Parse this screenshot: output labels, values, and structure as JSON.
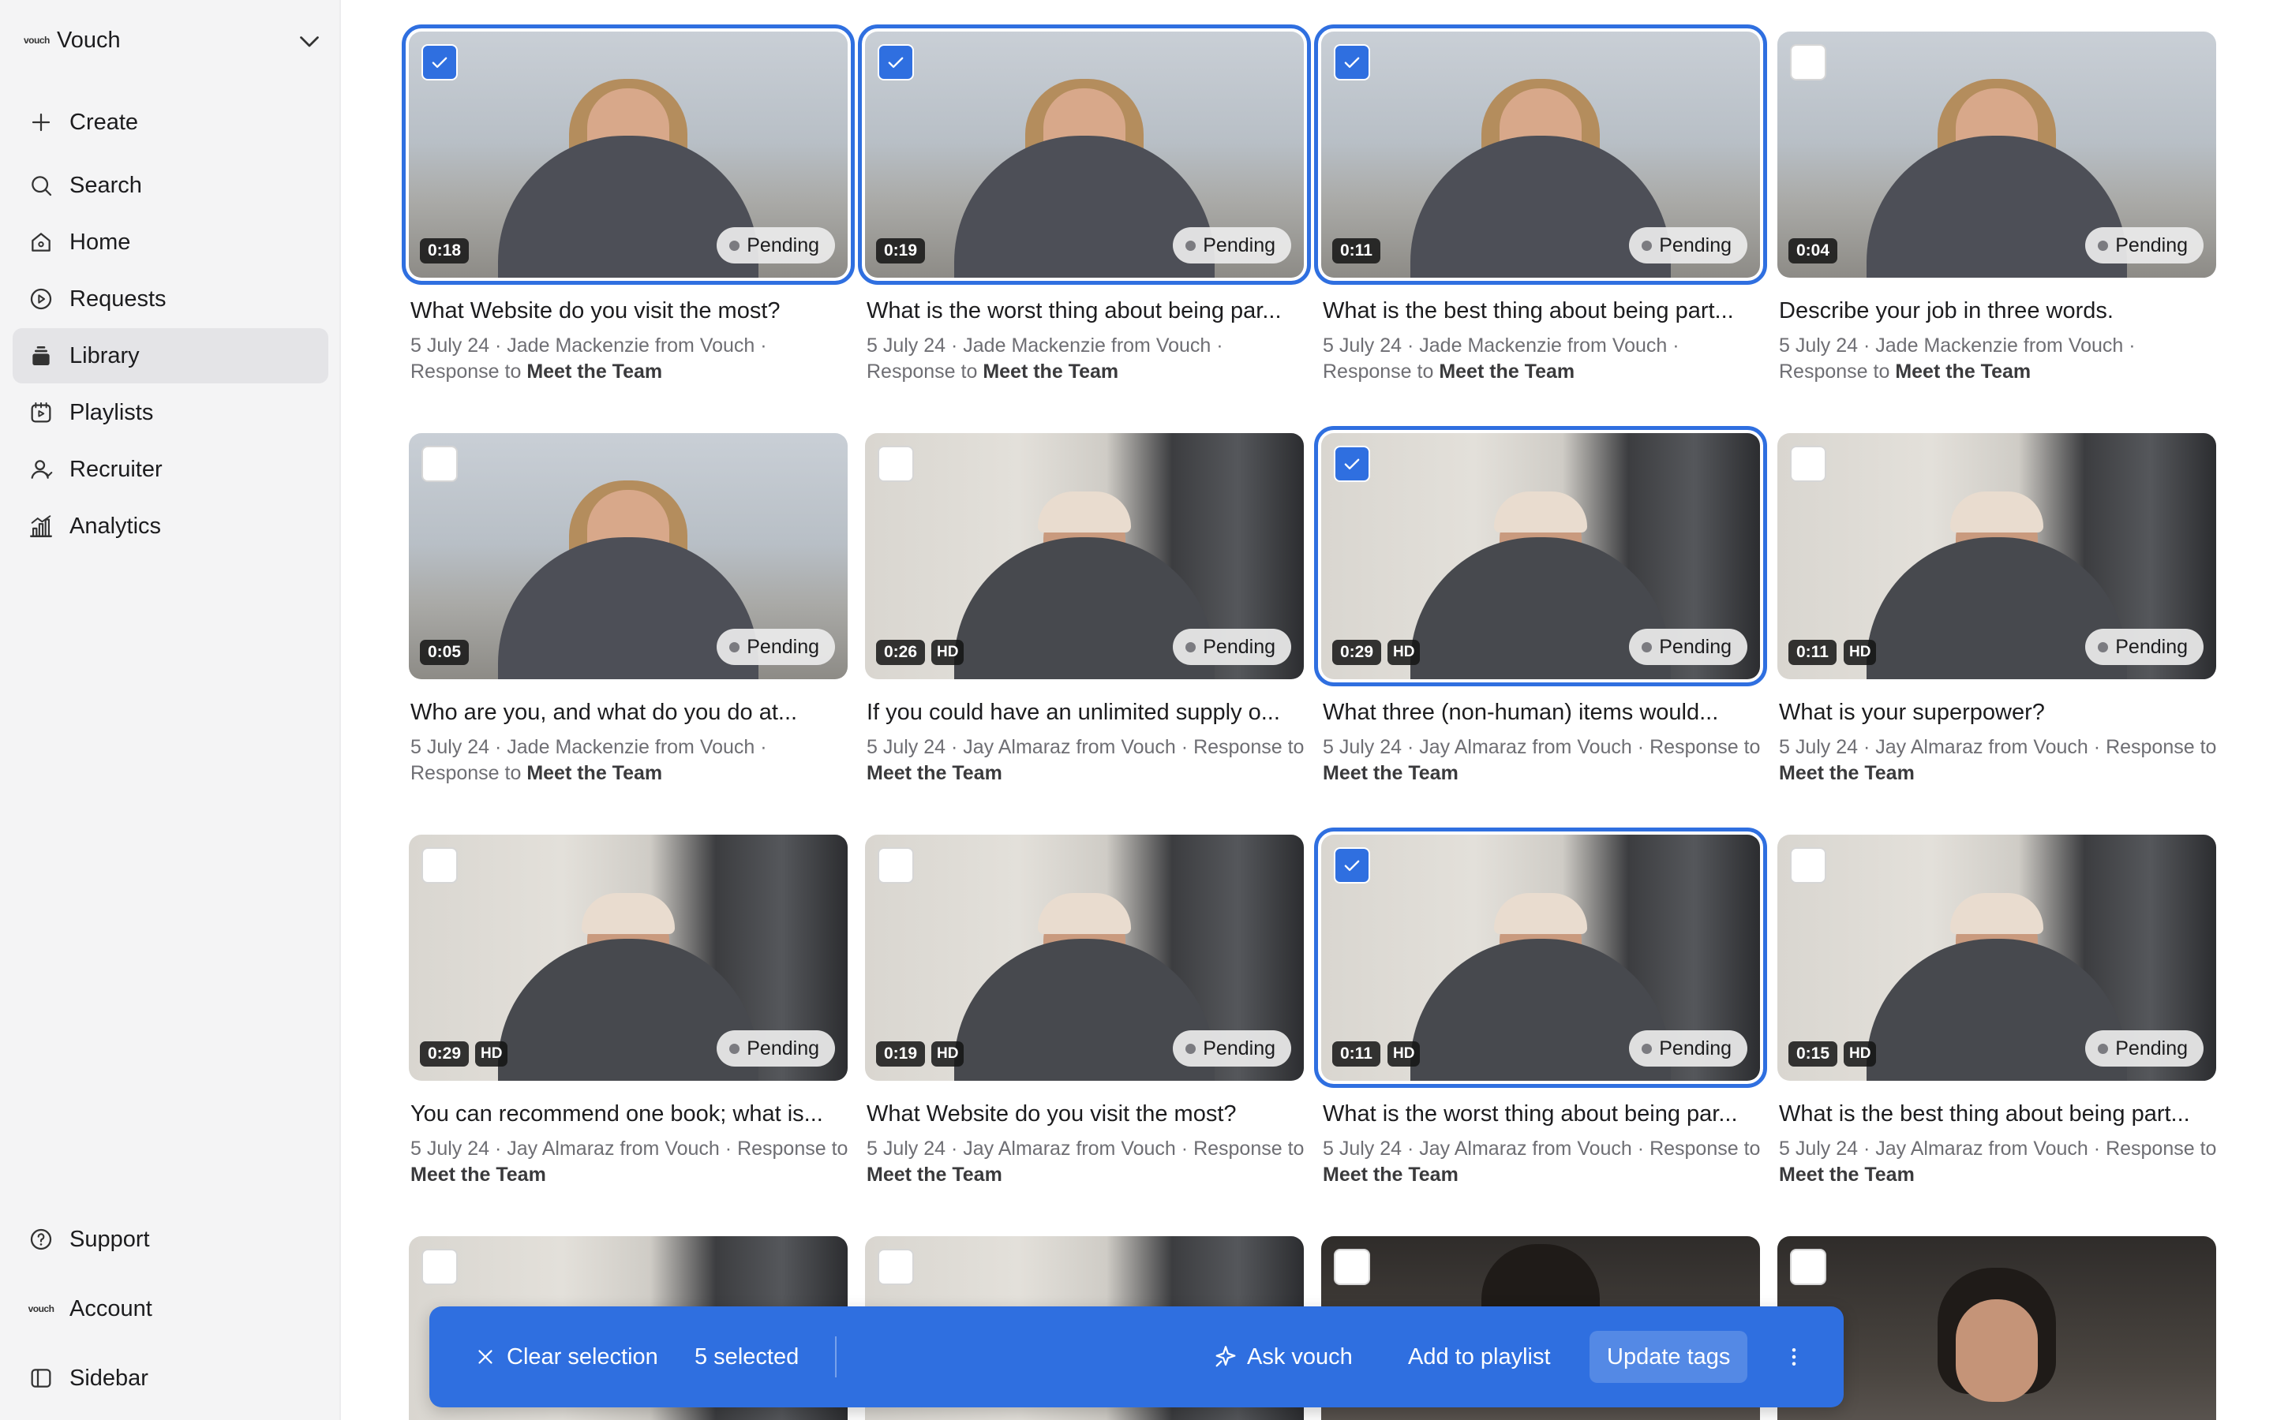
{
  "workspace": {
    "logo": "vouch",
    "name": "Vouch"
  },
  "nav": [
    {
      "label": "Create",
      "icon": "plus-icon"
    },
    {
      "label": "Search",
      "icon": "search-icon"
    },
    {
      "label": "Home",
      "icon": "home-icon"
    },
    {
      "label": "Requests",
      "icon": "play-circle-icon"
    },
    {
      "label": "Library",
      "icon": "stack-icon",
      "active": true
    },
    {
      "label": "Playlists",
      "icon": "playlist-icon"
    },
    {
      "label": "Recruiter",
      "icon": "user-icon"
    },
    {
      "label": "Analytics",
      "icon": "chart-icon"
    }
  ],
  "footer_nav": [
    {
      "label": "Support",
      "icon": "help-icon"
    },
    {
      "label": "Account",
      "logo": "vouch"
    },
    {
      "label": "Sidebar",
      "icon": "sidebar-icon"
    }
  ],
  "colors": {
    "accent": "#2f6fe0",
    "sidebar_bg": "#f4f4f5"
  },
  "cards": [
    {
      "title": "What Website do you visit the most?",
      "date": "5 July 24",
      "author": "Jade Mackenzie from Vouch",
      "response_prefix": "Response to",
      "campaign": "Meet the Team",
      "duration": "0:18",
      "hd": "",
      "status": "Pending",
      "selected": true
    },
    {
      "title": "What is the worst thing about being par...",
      "date": "5 July 24",
      "author": "Jade Mackenzie from Vouch",
      "response_prefix": "Response to",
      "campaign": "Meet the Team",
      "duration": "0:19",
      "hd": "",
      "status": "Pending",
      "selected": true
    },
    {
      "title": "What is the best thing about being part...",
      "date": "5 July 24",
      "author": "Jade Mackenzie from Vouch",
      "response_prefix": "Response to",
      "campaign": "Meet the Team",
      "duration": "0:11",
      "hd": "",
      "status": "Pending",
      "selected": true
    },
    {
      "title": "Describe your job in three words.",
      "date": "5 July 24",
      "author": "Jade Mackenzie from Vouch",
      "response_prefix": "Response to",
      "campaign": "Meet the Team",
      "duration": "0:04",
      "hd": "",
      "status": "Pending",
      "selected": false
    },
    {
      "title": "Who are you, and what do you do at...",
      "date": "5 July 24",
      "author": "Jade Mackenzie from Vouch",
      "response_prefix": "Response to",
      "campaign": "Meet the Team",
      "duration": "0:05",
      "hd": "",
      "status": "Pending",
      "selected": false
    },
    {
      "title": "If you could have an unlimited supply o...",
      "date": "5 July 24",
      "author": "Jay Almaraz from Vouch",
      "response_prefix": "Response to",
      "campaign": "Meet the Team",
      "duration": "0:26",
      "hd": "HD",
      "status": "Pending",
      "selected": false
    },
    {
      "title": "What three (non-human) items would...",
      "date": "5 July 24",
      "author": "Jay Almaraz from Vouch",
      "response_prefix": "Response to",
      "campaign": "Meet the Team",
      "duration": "0:29",
      "hd": "HD",
      "status": "Pending",
      "selected": true
    },
    {
      "title": "What is your superpower?",
      "date": "5 July 24",
      "author": "Jay Almaraz from Vouch",
      "response_prefix": "Response to",
      "campaign": "Meet the Team",
      "duration": "0:11",
      "hd": "HD",
      "status": "Pending",
      "selected": false
    },
    {
      "title": "You can recommend one book; what is...",
      "date": "5 July 24",
      "author": "Jay Almaraz from Vouch",
      "response_prefix": "Response to",
      "campaign": "Meet the Team",
      "duration": "0:29",
      "hd": "HD",
      "status": "Pending",
      "selected": false
    },
    {
      "title": "What Website do you visit the most?",
      "date": "5 July 24",
      "author": "Jay Almaraz from Vouch",
      "response_prefix": "Response to",
      "campaign": "Meet the Team",
      "duration": "0:19",
      "hd": "HD",
      "status": "Pending",
      "selected": false
    },
    {
      "title": "What is the worst thing about being par...",
      "date": "5 July 24",
      "author": "Jay Almaraz from Vouch",
      "response_prefix": "Response to",
      "campaign": "Meet the Team",
      "duration": "0:11",
      "hd": "HD",
      "status": "Pending",
      "selected": true
    },
    {
      "title": "What is the best thing about being part...",
      "date": "5 July 24",
      "author": "Jay Almaraz from Vouch",
      "response_prefix": "Response to",
      "campaign": "Meet the Team",
      "duration": "0:15",
      "hd": "HD",
      "status": "Pending",
      "selected": false
    },
    {
      "selected": false
    },
    {
      "selected": false
    },
    {
      "selected": false
    },
    {
      "selected": false
    }
  ],
  "action_bar": {
    "clear_label": "Clear selection",
    "selected_label": "5 selected",
    "ask_label": "Ask vouch",
    "playlist_label": "Add to playlist",
    "tags_label": "Update tags"
  }
}
